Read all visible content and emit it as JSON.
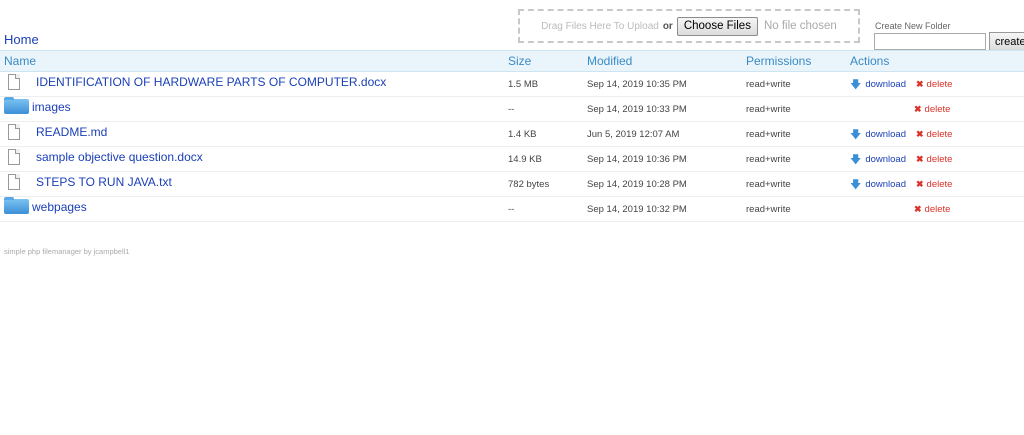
{
  "breadcrumb": {
    "home": "Home"
  },
  "upload": {
    "drag_text": "Drag Files Here To Upload",
    "or": "or",
    "choose_label": "Choose Files",
    "no_file": "No file chosen"
  },
  "mkdir": {
    "label": "Create New Folder",
    "input_value": "",
    "button_label": "create"
  },
  "table": {
    "headers": {
      "name": "Name",
      "size": "Size",
      "modified": "Modified",
      "permissions": "Permissions",
      "actions": "Actions"
    },
    "rows": [
      {
        "name": "IDENTIFICATION OF HARDWARE PARTS OF COMPUTER.docx",
        "icon": "file-icon",
        "size": "1.5 MB",
        "modified": "Sep 14, 2019 10:35 PM",
        "permissions": "read+write",
        "download": "download",
        "delete": "delete"
      },
      {
        "name": "images",
        "icon": "folder-icon",
        "size": "--",
        "modified": "Sep 14, 2019 10:33 PM",
        "permissions": "read+write",
        "delete": "delete"
      },
      {
        "name": "README.md",
        "icon": "file-icon",
        "size": "1.4 KB",
        "modified": "Jun 5, 2019 12:07 AM",
        "permissions": "read+write",
        "download": "download",
        "delete": "delete"
      },
      {
        "name": "sample objective question.docx",
        "icon": "file-icon",
        "size": "14.9 KB",
        "modified": "Sep 14, 2019 10:36 PM",
        "permissions": "read+write",
        "download": "download",
        "delete": "delete"
      },
      {
        "name": "STEPS TO RUN JAVA.txt",
        "icon": "file-icon",
        "size": "782 bytes",
        "modified": "Sep 14, 2019 10:28 PM",
        "permissions": "read+write",
        "download": "download",
        "delete": "delete"
      },
      {
        "name": "webpages",
        "icon": "folder-icon",
        "size": "--",
        "modified": "Sep 14, 2019 10:32 PM",
        "permissions": "read+write",
        "delete": "delete"
      }
    ]
  },
  "footer": {
    "text": "simple php filemanager by jcampbell1"
  },
  "colors": {
    "link": "#1a3fb8",
    "header_bg": "#eaf4fb",
    "header_text": "#3a8bc4",
    "delete": "#d9342b"
  }
}
